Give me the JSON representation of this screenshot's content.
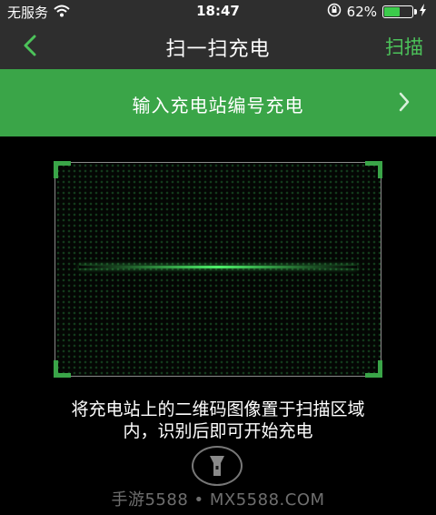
{
  "status_bar": {
    "carrier": "无服务",
    "time": "18:47",
    "battery_percent_text": "62%",
    "battery_level": 0.62,
    "icons": [
      "wifi-icon",
      "rotation-lock-icon",
      "battery-icon",
      "charging-bolt-icon"
    ]
  },
  "nav": {
    "back_icon": "chevron-left-icon",
    "title": "扫一扫充电",
    "action_label": "扫描"
  },
  "entry": {
    "label": "输入充电站编号充电",
    "icon": "chevron-right-icon"
  },
  "scanner": {
    "instruction_line1": "将充电站上的二维码图像置于扫描区域",
    "instruction_line2": "内，识别后即可开始充电"
  },
  "flashlight": {
    "icon": "flashlight-icon"
  },
  "watermark": {
    "text": "手游5588 • MX5588.COM"
  },
  "colors": {
    "accent": "#3aa548",
    "nav_bg": "#2e2e2e",
    "action_text": "#4cc35a"
  }
}
